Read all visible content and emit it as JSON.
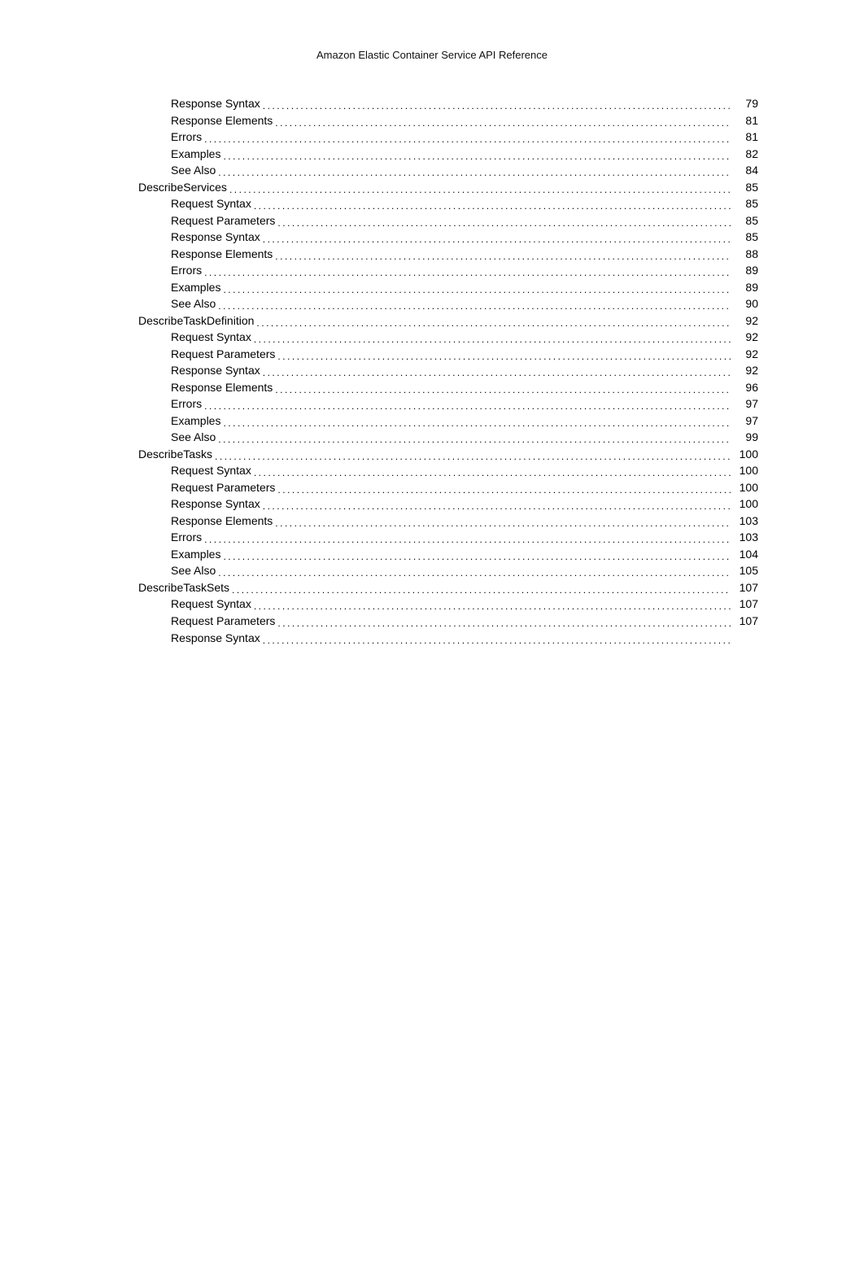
{
  "header": "Amazon Elastic Container Service API Reference",
  "toc": [
    {
      "indent": 2,
      "title": "Response Syntax",
      "page": "79"
    },
    {
      "indent": 2,
      "title": "Response Elements",
      "page": "81"
    },
    {
      "indent": 2,
      "title": "Errors",
      "page": "81"
    },
    {
      "indent": 2,
      "title": "Examples",
      "page": "82"
    },
    {
      "indent": 2,
      "title": "See Also",
      "page": "84"
    },
    {
      "indent": 1,
      "title": "DescribeServices",
      "page": "85"
    },
    {
      "indent": 2,
      "title": "Request Syntax",
      "page": "85"
    },
    {
      "indent": 2,
      "title": "Request Parameters",
      "page": "85"
    },
    {
      "indent": 2,
      "title": "Response Syntax",
      "page": "85"
    },
    {
      "indent": 2,
      "title": "Response Elements",
      "page": "88"
    },
    {
      "indent": 2,
      "title": "Errors",
      "page": "89"
    },
    {
      "indent": 2,
      "title": "Examples",
      "page": "89"
    },
    {
      "indent": 2,
      "title": "See Also",
      "page": "90"
    },
    {
      "indent": 1,
      "title": "DescribeTaskDefinition",
      "page": "92"
    },
    {
      "indent": 2,
      "title": "Request Syntax",
      "page": "92"
    },
    {
      "indent": 2,
      "title": "Request Parameters",
      "page": "92"
    },
    {
      "indent": 2,
      "title": "Response Syntax",
      "page": "92"
    },
    {
      "indent": 2,
      "title": "Response Elements",
      "page": "96"
    },
    {
      "indent": 2,
      "title": "Errors",
      "page": "97"
    },
    {
      "indent": 2,
      "title": "Examples",
      "page": "97"
    },
    {
      "indent": 2,
      "title": "See Also",
      "page": "99"
    },
    {
      "indent": 1,
      "title": "DescribeTasks",
      "page": "100"
    },
    {
      "indent": 2,
      "title": "Request Syntax",
      "page": "100"
    },
    {
      "indent": 2,
      "title": "Request Parameters",
      "page": "100"
    },
    {
      "indent": 2,
      "title": "Response Syntax",
      "page": "100"
    },
    {
      "indent": 2,
      "title": "Response Elements",
      "page": "103"
    },
    {
      "indent": 2,
      "title": "Errors",
      "page": "103"
    },
    {
      "indent": 2,
      "title": "Examples",
      "page": "104"
    },
    {
      "indent": 2,
      "title": "See Also",
      "page": "105"
    },
    {
      "indent": 1,
      "title": "DescribeTaskSets",
      "page": "107"
    },
    {
      "indent": 2,
      "title": "Request Syntax",
      "page": "107"
    },
    {
      "indent": 2,
      "title": "Request Parameters",
      "page": "107"
    },
    {
      "indent": 2,
      "title": "Response Syntax",
      "page": ""
    }
  ]
}
